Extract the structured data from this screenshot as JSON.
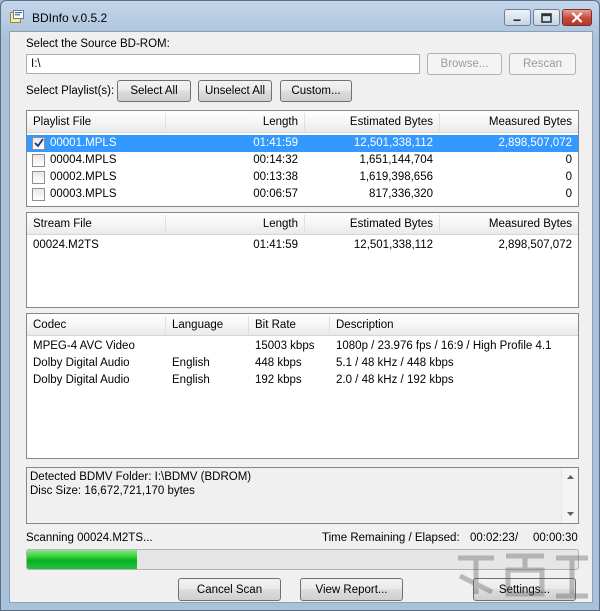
{
  "window": {
    "title": "BDInfo v.0.5.2",
    "icon": "bdinfo-app-icon",
    "controls": [
      "minimize-icon",
      "maximize-icon",
      "close-icon"
    ]
  },
  "source": {
    "label": "Select the Source BD-ROM:",
    "path_value": "I:\\",
    "browse_label": "Browse...",
    "rescan_label": "Rescan"
  },
  "playlist_select": {
    "label": "Select Playlist(s):",
    "select_all_label": "Select All",
    "unselect_all_label": "Unselect All",
    "custom_label": "Custom..."
  },
  "playlists": {
    "columns": [
      "Playlist File",
      "Length",
      "Estimated Bytes",
      "Measured Bytes"
    ],
    "rows": [
      {
        "file": "00001.MPLS",
        "length": "01:41:59",
        "estimated": "12,501,338,112",
        "measured": "2,898,507,072",
        "checked": true,
        "selected": true
      },
      {
        "file": "00004.MPLS",
        "length": "00:14:32",
        "estimated": "1,651,144,704",
        "measured": "0",
        "checked": false,
        "selected": false
      },
      {
        "file": "00002.MPLS",
        "length": "00:13:38",
        "estimated": "1,619,398,656",
        "measured": "0",
        "checked": false,
        "selected": false
      },
      {
        "file": "00003.MPLS",
        "length": "00:06:57",
        "estimated": "817,336,320",
        "measured": "0",
        "checked": false,
        "selected": false
      }
    ]
  },
  "streams": {
    "columns": [
      "Stream File",
      "Length",
      "Estimated Bytes",
      "Measured Bytes"
    ],
    "rows": [
      {
        "file": "00024.M2TS",
        "length": "01:41:59",
        "estimated": "12,501,338,112",
        "measured": "2,898,507,072"
      }
    ]
  },
  "codecs": {
    "columns": [
      "Codec",
      "Language",
      "Bit Rate",
      "Description"
    ],
    "rows": [
      {
        "codec": "MPEG-4 AVC Video",
        "language": "",
        "bitrate": "15003 kbps",
        "description": "1080p / 23.976 fps / 16:9 / High Profile 4.1"
      },
      {
        "codec": "Dolby Digital Audio",
        "language": "English",
        "bitrate": "448 kbps",
        "description": "5.1 / 48 kHz / 448 kbps"
      },
      {
        "codec": "Dolby Digital Audio",
        "language": "English",
        "bitrate": "192 kbps",
        "description": "2.0 / 48 kHz / 192 kbps"
      }
    ]
  },
  "info": {
    "line1": "Detected BDMV Folder: I:\\BDMV (BDROM)",
    "line2": "Disc Size: 16,672,721,170 bytes"
  },
  "status": {
    "scanning_text": "Scanning 00024.M2TS...",
    "time_label": "Time Remaining / Elapsed:",
    "remaining": "00:02:23",
    "separator": "/",
    "elapsed": "00:00:30",
    "progress_fraction": 0.2,
    "progress_color": "#06b025"
  },
  "buttons": {
    "cancel_scan_label": "Cancel Scan",
    "view_report_label": "View Report...",
    "settings_label": "Settings..."
  },
  "colors": {
    "selection": "#3399ff",
    "close_button": "#c5483b"
  }
}
